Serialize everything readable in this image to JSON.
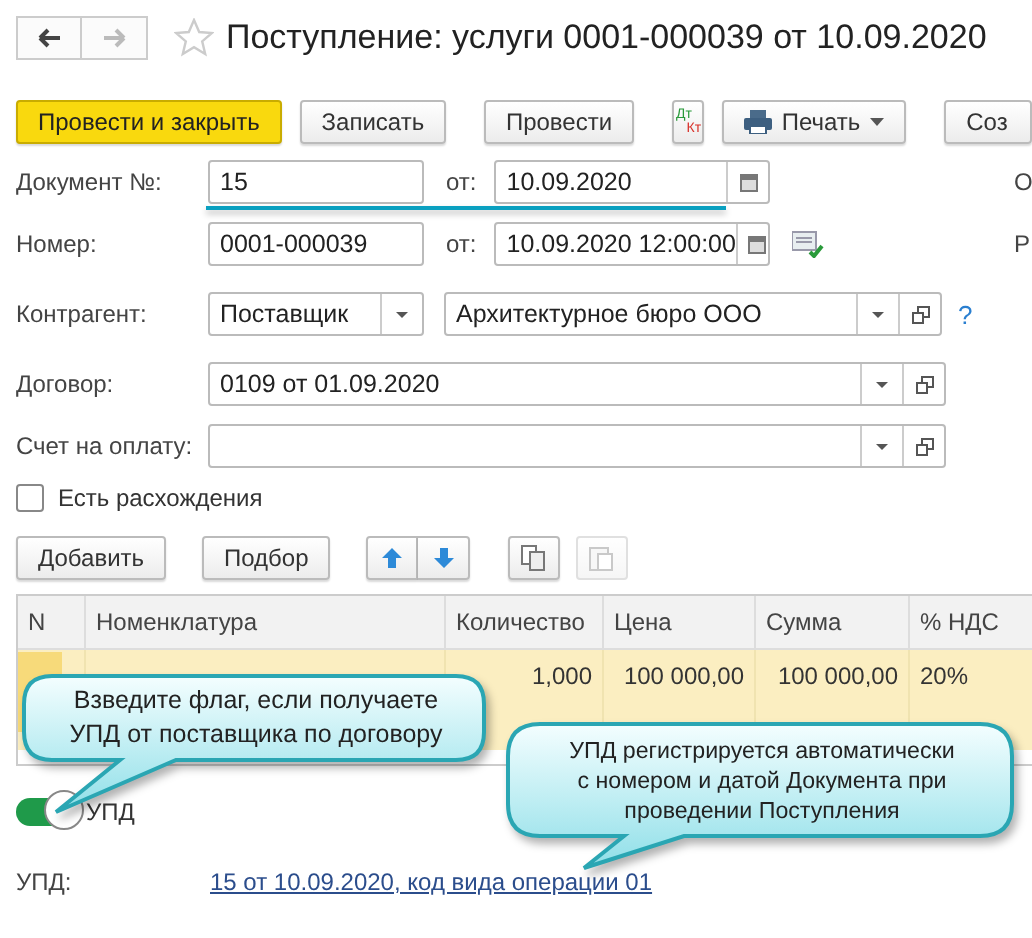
{
  "window": {
    "title": "Поступление: услуги 0001-000039 от 10.09.2020",
    "favorite": false
  },
  "toolbar": [
    {
      "kind": "primary",
      "label": "Провести и закрыть"
    },
    {
      "kind": "plain",
      "label": "Записать"
    },
    {
      "kind": "plain",
      "label": "Провести"
    },
    {
      "kind": "dtkt",
      "top": "Дт",
      "bottom": "Кт"
    },
    {
      "kind": "menu",
      "label": "Печать"
    },
    {
      "kind": "plain",
      "label": "Соз"
    }
  ],
  "doc_number": {
    "label": "Документ №:",
    "value": "15",
    "date_label": "от:",
    "date": "10.09.2020",
    "side_text": "О"
  },
  "number": {
    "label": "Номер:",
    "value": "0001-000039",
    "date_label": "от:",
    "date": "10.09.2020 12:00:00",
    "side_text": "Р"
  },
  "counterparty": {
    "label": "Контрагент:",
    "type": "Поставщик",
    "value": "Архитектурное бюро ООО",
    "help": "?"
  },
  "contract": {
    "label": "Договор:",
    "value": "0109 от 01.09.2020"
  },
  "invoice": {
    "label": "Счет на оплату:"
  },
  "discrepancy": {
    "label": "Есть расхождения",
    "checked": false
  },
  "table_buttons": [
    {
      "kind": "text",
      "label": "Добавить",
      "disabled": false
    },
    {
      "kind": "text",
      "label": "Подбор",
      "disabled": false
    },
    {
      "kind": "up",
      "disabled": false
    },
    {
      "kind": "down",
      "disabled": false
    },
    {
      "kind": "copy",
      "disabled": false
    },
    {
      "kind": "paste",
      "disabled": true
    }
  ],
  "table": {
    "columns": [
      "N",
      "Номенклатура",
      "Количество",
      "Цена",
      "Сумма",
      "% НДС"
    ],
    "rows": [
      {
        "selected": true,
        "quantity": "1,000",
        "price": "100 000,00",
        "sum": "100 000,00",
        "vat": "20%"
      }
    ]
  },
  "upd_toggle": {
    "label": "УПД",
    "on": true
  },
  "upd": {
    "label": "УПД:",
    "link": "15 от 10.09.2020, код вида операции 01"
  },
  "callouts": [
    {
      "text": "Взведите флаг, если получаете УПД от поставщика по договору"
    },
    {
      "text": "УПД регистрируется автоматически с номером и датой Документа при проведении Поступления"
    }
  ]
}
